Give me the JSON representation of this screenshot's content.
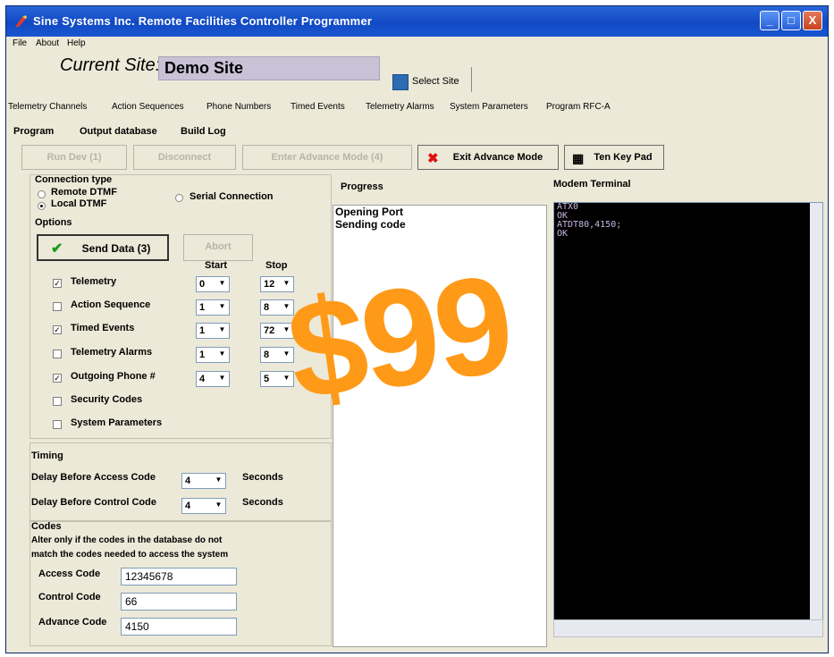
{
  "window": {
    "title": "Sine Systems Inc. Remote Facilities Controller Programmer",
    "min": "_",
    "max": "□",
    "close": "X"
  },
  "menu": [
    "File",
    "About",
    "Help"
  ],
  "site": {
    "label": "Current Site:",
    "name": "Demo Site",
    "select_label": "Select Site"
  },
  "tabs_main": [
    "Telemetry Channels",
    "Action Sequences",
    "Phone Numbers",
    "Timed Events",
    "Telemetry Alarms",
    "System Parameters",
    "Program RFC-A"
  ],
  "tabs_sub": [
    "Program",
    "Output database",
    "Build Log"
  ],
  "toolbar": {
    "b1": "Run Dev (1)",
    "b2": "Disconnect",
    "b3": "Enter Advance Mode (4)",
    "exit": "Exit Advance Mode",
    "tenkey": "Ten Key Pad"
  },
  "connection": {
    "title": "Connection type",
    "remote": "Remote DTMF",
    "serial": "Serial Connection",
    "local": "Local DTMF"
  },
  "options": {
    "title": "Options",
    "send": "Send Data (3)",
    "abort": "Abort",
    "start": "Start",
    "stop": "Stop",
    "rows": [
      {
        "label": "Telemetry",
        "checked": "✓",
        "start": "0",
        "stop": "12"
      },
      {
        "label": "Action Sequence",
        "checked": "",
        "start": "1",
        "stop": "8"
      },
      {
        "label": "Timed Events",
        "checked": "✓",
        "start": "1",
        "stop": "72"
      },
      {
        "label": "Telemetry Alarms",
        "checked": "",
        "start": "1",
        "stop": "8"
      },
      {
        "label": "Outgoing Phone #",
        "checked": "✓",
        "start": "4",
        "stop": "5"
      },
      {
        "label": "Security Codes",
        "checked": "",
        "start": "",
        "stop": ""
      },
      {
        "label": "System Parameters",
        "checked": "",
        "start": "",
        "stop": ""
      }
    ]
  },
  "timing": {
    "title": "Timing",
    "access_label": "Delay Before Access Code",
    "access_value": "4",
    "control_label": "Delay Before Control Code",
    "control_value": "4",
    "unit": "Seconds"
  },
  "codes": {
    "title": "Codes",
    "note1": "Alter only if the codes in the database do not",
    "note2": "match the codes needed to access the system",
    "access_label": "Access Code",
    "access_value": "12345678",
    "control_label": "Control Code",
    "control_value": "66",
    "advance_label": "Advance Code",
    "advance_value": "4150"
  },
  "progress": {
    "title": "Progress",
    "lines": [
      "Opening Port",
      "Sending code"
    ]
  },
  "modem": {
    "title": "Modem Terminal",
    "lines": [
      "ATX0",
      "OK",
      "ATDT80,4150;",
      "OK"
    ]
  },
  "promo": "$99",
  "colors": {
    "promo": "#ff9a18",
    "title_bar": "#1149c4",
    "terminal_text": "#c9b6e4"
  }
}
